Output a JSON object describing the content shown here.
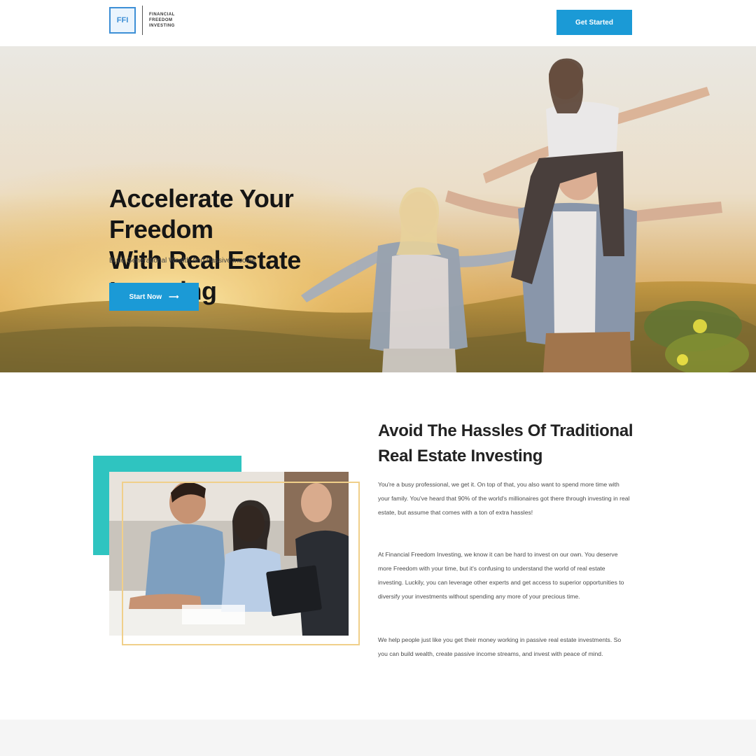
{
  "header": {
    "logo_abbrev": "FFI",
    "logo_text": "FINANCIAL FREEDOM INVESTING",
    "cta_label": "Get Started"
  },
  "hero": {
    "title_line1": "Accelerate Your Freedom",
    "title_line2": "With Real Estate Investing",
    "subtitle": "Build Generational Wealth And Passive Income",
    "button_label": "Start Now",
    "button_arrow": "⟶"
  },
  "about": {
    "title_line1": "Avoid The Hassles Of Traditional",
    "title_line2": "Real Estate Investing",
    "paragraphs": [
      "You're a busy professional, we get it. On top of that, you also want to spend more time with your family. You've heard that 90% of the world's millionaires got there through investing in real estate, but assume that comes with a ton of extra hassles!",
      "At Financial Freedom Investing, we know it can be hard to invest on our own. You deserve more Freedom with your time, but it's confusing to understand the world of real estate investing. Luckily, you can leverage other experts and get access to superior opportunities to diversify your investments without spending any more of your precious time.",
      "We help people just like you get their money working in passive real estate investments. So you can build wealth, create passive income streams, and invest with peace of mind."
    ]
  },
  "colors": {
    "accent": "#1b9ad6",
    "teal": "#2fc4c0",
    "frame": "#f0cf8a"
  }
}
